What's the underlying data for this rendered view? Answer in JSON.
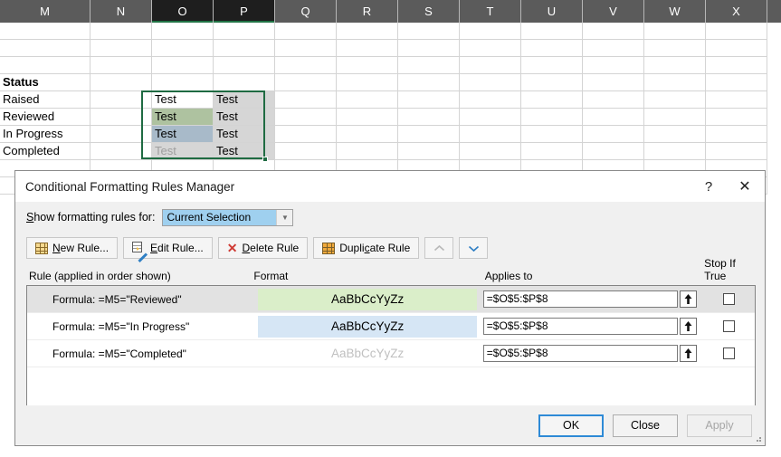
{
  "spreadsheet": {
    "columns": [
      "M",
      "N",
      "O",
      "P",
      "Q",
      "R",
      "S",
      "T",
      "U",
      "V",
      "W",
      "X"
    ],
    "selected_columns": [
      "O",
      "P"
    ],
    "status_header": "Status",
    "status_rows": [
      "Raised",
      "Reviewed",
      "In Progress",
      "Completed"
    ],
    "cell_text": "Test",
    "colors": {
      "green_fill": "#aec2a0",
      "blue_fill": "#a8bac9",
      "selection_border": "#1f6b42",
      "selection_shade": "#d6d6d6",
      "grey_text": "#9f9f9f"
    }
  },
  "dialog": {
    "title": "Conditional Formatting Rules Manager",
    "help_icon": "?",
    "close_icon": "✕",
    "show_rules_label": "Show formatting rules for:",
    "show_rules_value": "Current Selection",
    "toolbar": {
      "new_rule": "New Rule...",
      "edit_rule": "Edit Rule...",
      "delete_rule": "Delete Rule",
      "duplicate_rule": "Duplicate Rule",
      "move_up": "▲",
      "move_down": "▼"
    },
    "table": {
      "headers": {
        "rule": "Rule (applied in order shown)",
        "format": "Format",
        "applies_to": "Applies to",
        "stop_if_true": "Stop If True"
      },
      "rows": [
        {
          "rule": "Formula: =M5=\"Reviewed\"",
          "format_preview": "AaBbCcYyZz",
          "format_bg": "#daeec9",
          "format_color": "#000000",
          "applies_to": "=$O$5:$P$8",
          "stop_if_true": false,
          "selected": true
        },
        {
          "rule": "Formula: =M5=\"In Progress\"",
          "format_preview": "AaBbCcYyZz",
          "format_bg": "#d6e6f5",
          "format_color": "#000000",
          "applies_to": "=$O$5:$P$8",
          "stop_if_true": false,
          "selected": false
        },
        {
          "rule": "Formula: =M5=\"Completed\"",
          "format_preview": "AaBbCcYyZz",
          "format_bg": "transparent",
          "format_color": "#c0c0c0",
          "applies_to": "=$O$5:$P$8",
          "stop_if_true": false,
          "selected": false
        }
      ]
    },
    "footer": {
      "ok": "OK",
      "close": "Close",
      "apply": "Apply"
    }
  }
}
